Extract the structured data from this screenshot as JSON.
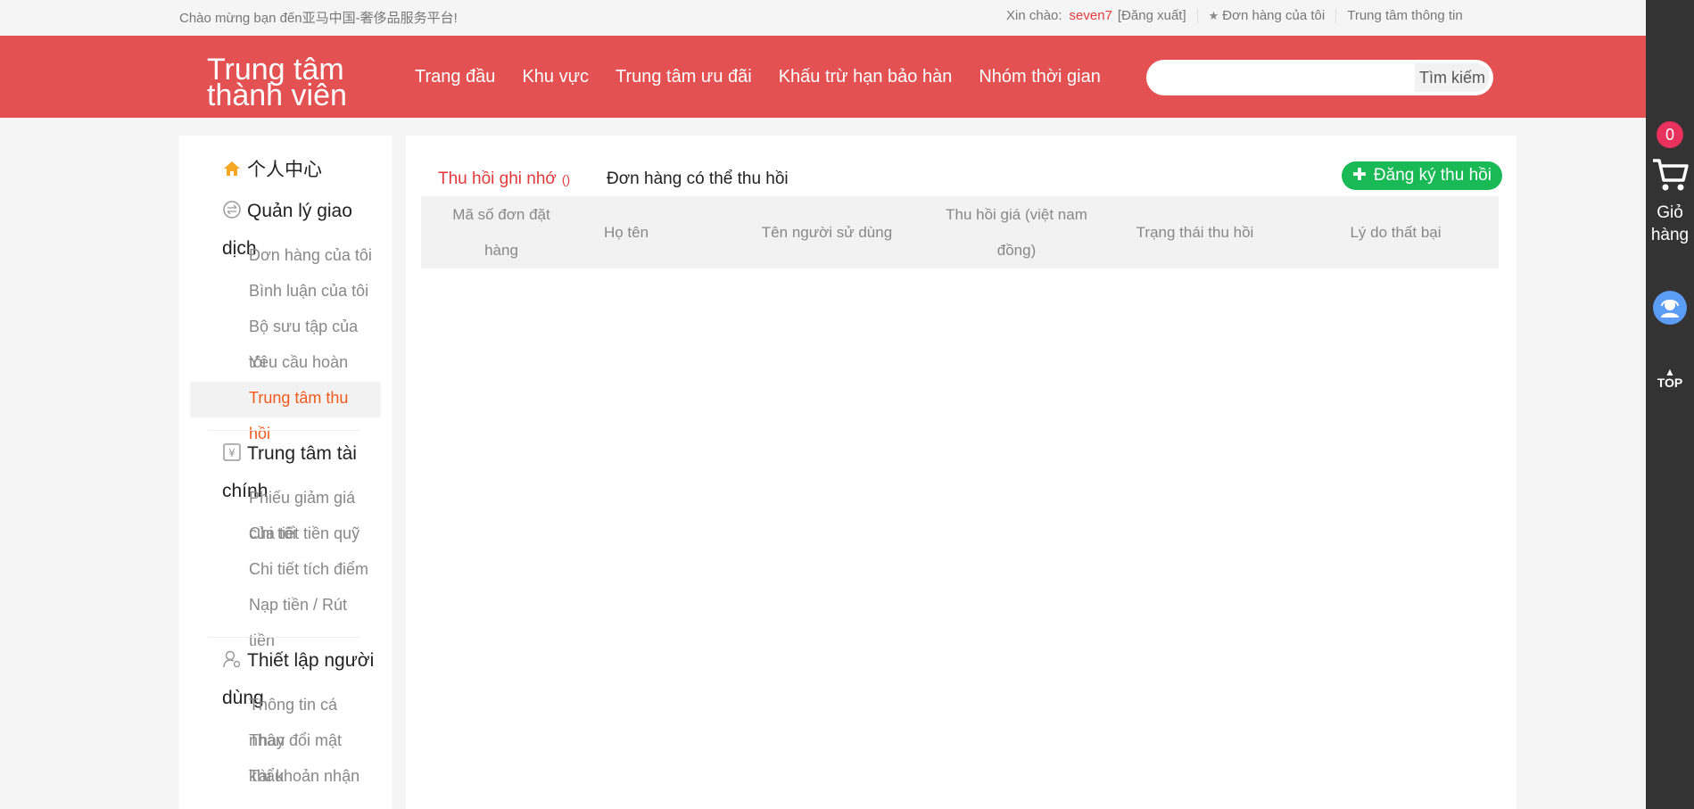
{
  "topbar": {
    "welcome": "Chào mừng bạn đến亚马中国-奢侈品服务平台!",
    "greeting": "Xin chào:",
    "username": "seven7",
    "logout": "[Đăng xuất]",
    "my_orders": "Đơn hàng của tôi",
    "info_center": "Trung tâm thông tin"
  },
  "header": {
    "logo_line1": "Trung tâm",
    "logo_line2": "thành viên",
    "nav": [
      "Trang đầu",
      "Khu vực",
      "Trung tâm ưu đãi",
      "Khấu trừ hạn bảo hàn",
      "Nhóm thời gian"
    ],
    "search_placeholder": "",
    "search_button": "Tìm kiếm"
  },
  "sidebar": {
    "personal_center": "个人中心",
    "transaction_mgmt_1": "Quản lý giao",
    "transaction_mgmt_2": "dịch",
    "transaction_items": [
      "Đơn hàng của tôi",
      "Bình luận của tôi",
      "Bộ sưu tập của",
      "Yêu cầu hoàn",
      "Trung tâm thu",
      "hồi"
    ],
    "transaction_items_overflow": [
      "tôi",
      "tôi"
    ],
    "finance_center_1": "Trung tâm tài",
    "finance_center_2": "chính",
    "finance_items": [
      "Phiếu giảm giá",
      "Chi tiết tiền quỹ",
      "Chi tiết tích điểm",
      "Nạp tiền / Rút",
      "tiền"
    ],
    "finance_overflow": "của tôi",
    "user_settings_1": "Thiết lập người",
    "user_settings_2": "dùng",
    "settings_items": [
      "Thông tin cá",
      "Thay đổi mật",
      "Tài khoản nhận"
    ],
    "settings_overflow": [
      "nhân",
      "khẩu"
    ]
  },
  "main": {
    "tab_active": "Thu hồi ghi nhớ",
    "tab_active_count": "()",
    "tab_other": "Đơn hàng có thể thu hồi",
    "register_button": "Đăng ký thu hồi",
    "columns": [
      "Mã số đơn đặt hàng",
      "Họ tên",
      "Tên người sử dùng",
      "Thu hồi giá (việt nam đồng)",
      "Trạng thái thu hồi",
      "Lý do thất bại"
    ]
  },
  "rightbar": {
    "cart_count": "0",
    "cart_label": "Giỏ hàng",
    "top_label": "TOP"
  }
}
